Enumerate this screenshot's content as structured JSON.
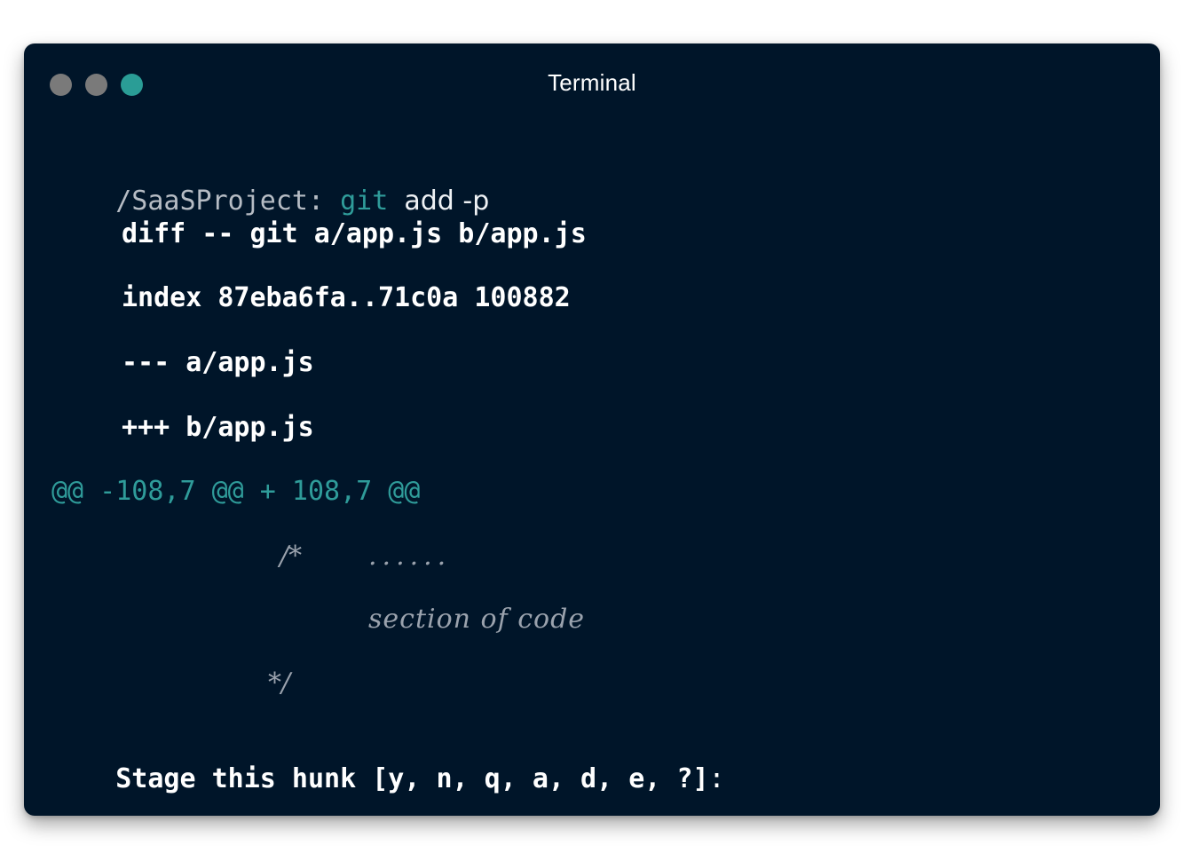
{
  "window": {
    "title": "Terminal",
    "controls": [
      {
        "name": "close",
        "color": "#7a7a7a"
      },
      {
        "name": "minimize",
        "color": "#7a7a7a"
      },
      {
        "name": "zoom",
        "color": "#2a9d96"
      }
    ]
  },
  "colors": {
    "background": "#001529",
    "accent": "#2f9c9a",
    "text": "#ffffff",
    "muted": "#9aa2ad"
  },
  "terminal": {
    "prompt_path": "/SaaSProject:",
    "prompt_cmd": "git",
    "prompt_args": "add -p",
    "diff_header": "diff -- git a/app.js b/app.js",
    "index_line": "index 87eba6fa..71c0a 100882",
    "old_file": "--- a/app.js",
    "new_file": "+++ b/app.js",
    "hunk_header": "@@ -108,7 @@ + 108,7 @@",
    "comment_open": "/*",
    "comment_dots": "......",
    "comment_text": "section of code",
    "comment_close": "*/",
    "stage_prompt": "Stage this hunk [y, n, q, a, d, e, ?]",
    "stage_colon": ":"
  }
}
